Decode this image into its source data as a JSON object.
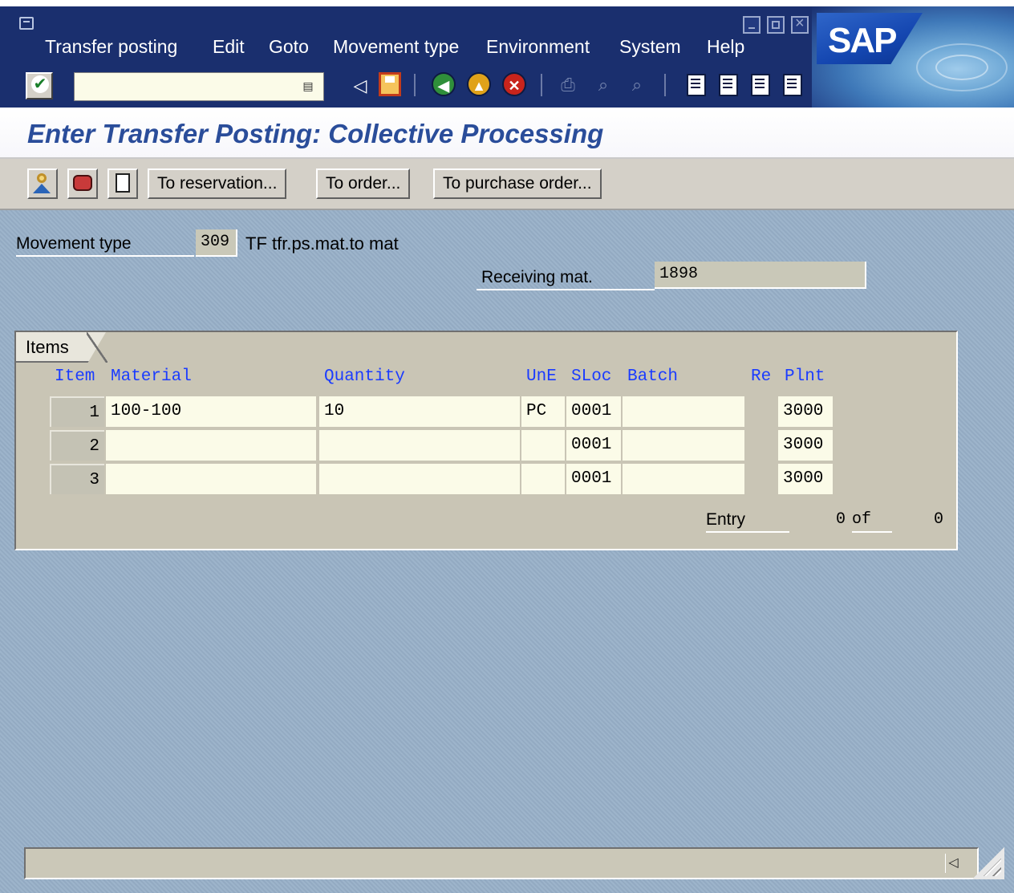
{
  "menu": {
    "items": [
      "Transfer posting",
      "Edit",
      "Goto",
      "Movement type",
      "Environment",
      "System",
      "Help"
    ]
  },
  "branding": {
    "logo_text": "SAP"
  },
  "system_toolbar": {
    "command_value": "",
    "icons": [
      "enter-icon",
      "command-dropdown-icon",
      "back-small-icon",
      "save-icon",
      "back-icon",
      "exit-icon",
      "cancel-icon",
      "print-icon",
      "find-icon",
      "find-next-icon",
      "first-page-icon",
      "previous-page-icon",
      "next-page-icon",
      "last-page-icon"
    ]
  },
  "title": "Enter Transfer Posting: Collective Processing",
  "app_toolbar": {
    "buttons": [
      "To reservation...",
      "To order...",
      "To purchase order..."
    ]
  },
  "header": {
    "movement_type_label": "Movement type",
    "movement_type_value": "309",
    "movement_type_desc": "TF tfr.ps.mat.to mat",
    "receiving_mat_label": "Receiving mat.",
    "receiving_mat_value": "1898"
  },
  "items": {
    "tab_label": "Items",
    "columns": [
      "Item",
      "Material",
      "Quantity",
      "UnE",
      "SLoc",
      "Batch",
      "Re",
      "Plnt"
    ],
    "rows": [
      {
        "item": "1",
        "material": "100-100",
        "quantity": "10",
        "unit": "PC",
        "sloc": "0001",
        "batch": "",
        "plant": "3000"
      },
      {
        "item": "2",
        "material": "",
        "quantity": "",
        "unit": "",
        "sloc": "0001",
        "batch": "",
        "plant": "3000"
      },
      {
        "item": "3",
        "material": "",
        "quantity": "",
        "unit": "",
        "sloc": "0001",
        "batch": "",
        "plant": "3000"
      }
    ],
    "entry_label": "Entry",
    "entry_current": "0",
    "entry_of": "of",
    "entry_total": "0"
  },
  "colors": {
    "menu_bg": "#1a2f6e",
    "title_text": "#2a4d9a",
    "workarea_bg": "#98b0c8",
    "column_header": "#1b3cff",
    "input_bg": "#fbfbe8"
  }
}
